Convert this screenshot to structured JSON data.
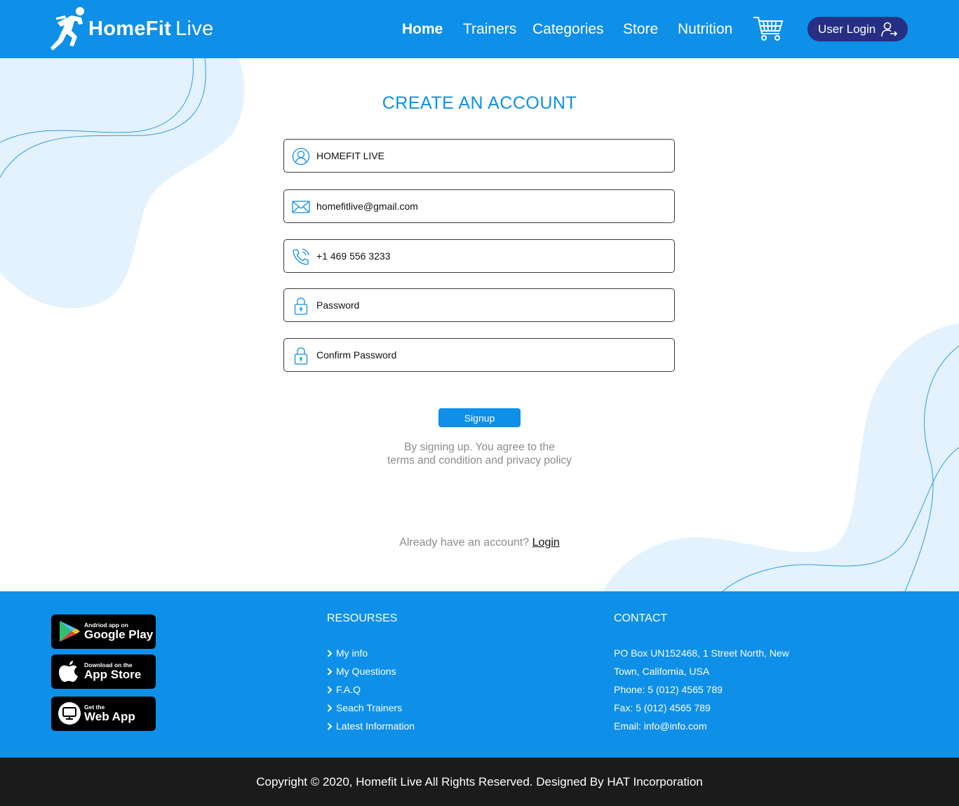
{
  "header": {
    "logo": {
      "brand_bold": "HomeFit",
      "brand_light": "Live"
    },
    "nav": [
      {
        "label": "Home",
        "active": true
      },
      {
        "label": "Trainers",
        "active": false
      },
      {
        "label": "Categories",
        "active": false
      },
      {
        "label": "Store",
        "active": false
      },
      {
        "label": "Nutrition",
        "active": false
      }
    ],
    "cart_icon": "shopping-cart-icon",
    "user_login_label": "User Login",
    "user_login_icon": "user-login-icon"
  },
  "form": {
    "title": "CREATE AN ACCOUNT",
    "fields": [
      {
        "icon": "user-icon",
        "value": "HOMEFIT LIVE"
      },
      {
        "icon": "mail-icon",
        "value": "homefitlive@gmail.com"
      },
      {
        "icon": "phone-icon",
        "value": "+1 469 556 3233"
      },
      {
        "icon": "lock-icon",
        "value": "Password"
      },
      {
        "icon": "lock-icon",
        "value": "Confirm Password"
      }
    ],
    "signup_label": "Signup",
    "terms_line1": "By signing up. You agree to the",
    "terms_line2": "terms and condition and privacy policy",
    "already_text": "Already have an account?",
    "login_link": "Login"
  },
  "footer": {
    "badges": [
      {
        "icon": "google-play-icon",
        "small": "Andriod app on",
        "big": "Google Play"
      },
      {
        "icon": "apple-icon",
        "small": "Download on the",
        "big": "App Store"
      },
      {
        "icon": "monitor-icon",
        "small": "Get the",
        "big": "Web App"
      }
    ],
    "resources_heading": "RESOURSES",
    "resources": [
      "My info",
      "My Questions",
      "F.A.Q",
      "Seach Trainers",
      "Latest Information"
    ],
    "contact_heading": "CONTACT",
    "contact": {
      "address": "PO Box UN152468, 1 Street North, New Town, California, USA",
      "phone": "Phone: 5 (012) 4565 789",
      "fax": "Fax: 5 (012) 4565 789",
      "email": "Email: info@info.com"
    },
    "copyright": "Copyright © 2020, Homefit Live All Rights Reserved. Designed By HAT Incorporation"
  },
  "colors": {
    "primary": "#0e8fe8",
    "login_button": "#262f83",
    "copyright_bar": "#1b1b1b",
    "blob": "#e3f2fc"
  }
}
